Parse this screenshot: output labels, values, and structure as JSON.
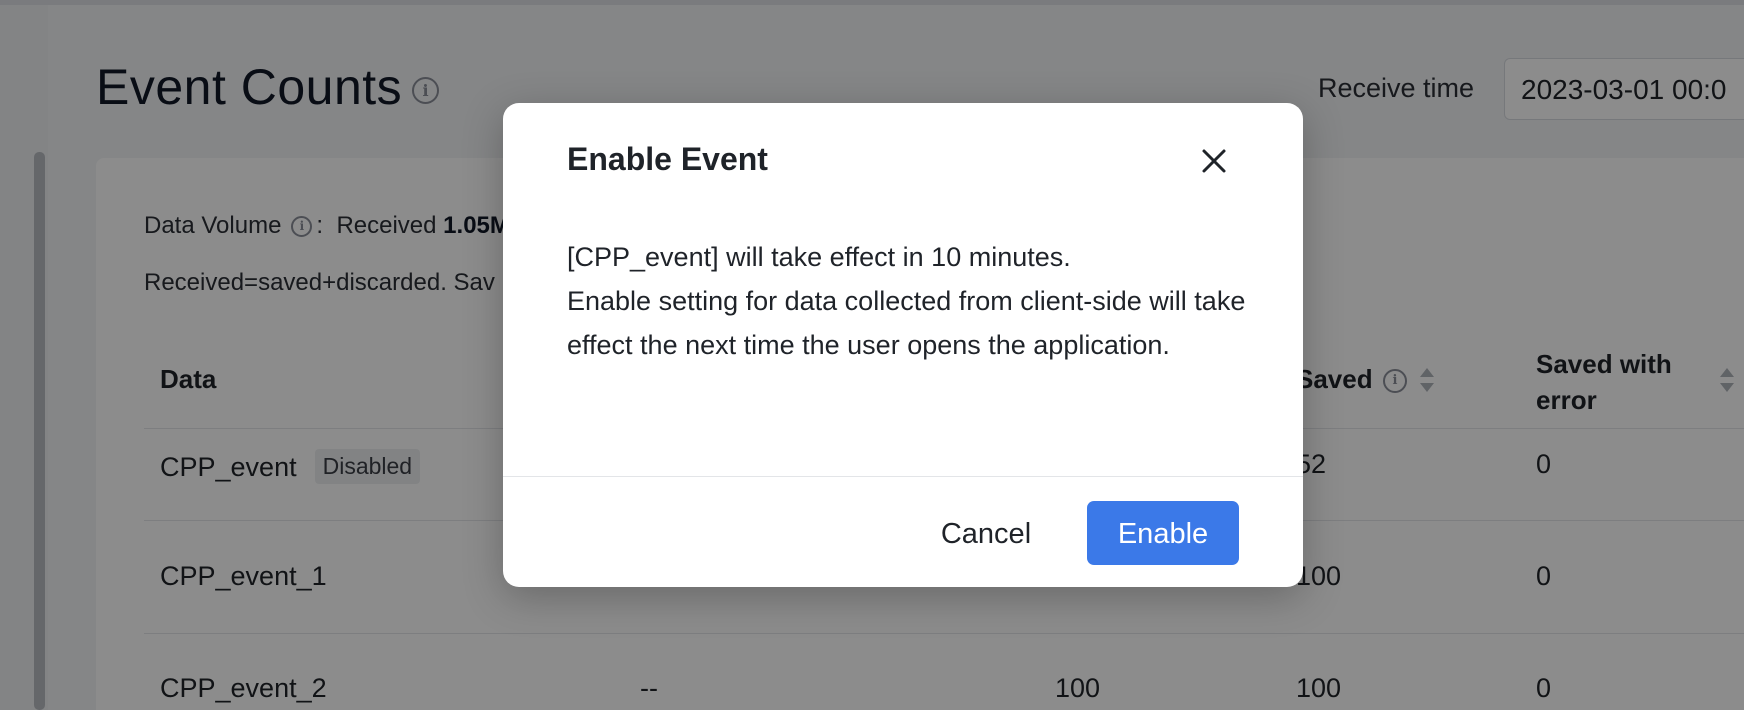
{
  "page": {
    "title": "Event Counts",
    "receive_time_label": "Receive time",
    "receive_time_value": "2023-03-01 00:0"
  },
  "summary": {
    "data_volume_label": "Data Volume",
    "received_label": "Received",
    "received_value": "1.05M",
    "note": "Received=saved+discarded. Sav"
  },
  "table": {
    "headers": {
      "data": "Data",
      "saved": "Saved",
      "saved_with_error": "Saved with error"
    },
    "rows": [
      {
        "name": "CPP_event",
        "tag": "Disabled",
        "col2": "",
        "col3": "",
        "saved": "52",
        "saved_with_error": "0"
      },
      {
        "name": "CPP_event_1",
        "tag": "",
        "col2": "",
        "col3": "",
        "saved": "100",
        "saved_with_error": "0"
      },
      {
        "name": "CPP_event_2",
        "tag": "",
        "col2": "--",
        "col3": "100",
        "saved": "100",
        "saved_with_error": "0"
      }
    ]
  },
  "modal": {
    "title": "Enable Event",
    "line1": "[CPP_event] will take effect in 10 minutes.",
    "line2": "Enable setting for data collected from client-side will take effect the next time the user opens the application.",
    "cancel_label": "Cancel",
    "enable_label": "Enable"
  },
  "colors": {
    "primary": "#3b79e8",
    "overlay": "rgba(0,0,0,0.45)"
  }
}
